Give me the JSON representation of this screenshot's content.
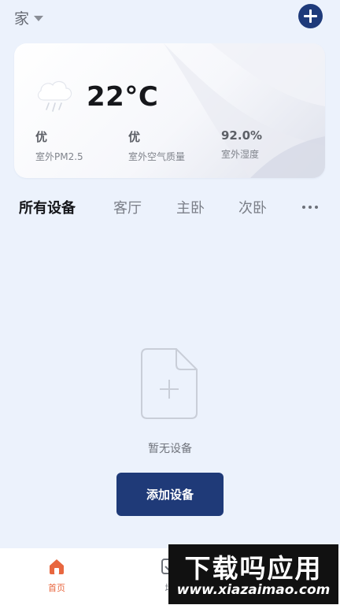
{
  "header": {
    "home_label": "家",
    "caret_icon": "caret-down-icon",
    "add_icon": "plus-circle-icon",
    "accent_color": "#1e3a7a"
  },
  "weather": {
    "icon": "cloud-rain-icon",
    "temperature": "22°C",
    "stats": [
      {
        "value": "优",
        "label": "室外PM2.5"
      },
      {
        "value": "优",
        "label": "室外空气质量"
      },
      {
        "value": "92.0%",
        "label": "室外湿度"
      }
    ]
  },
  "tabs": {
    "items": [
      {
        "label": "所有设备",
        "active": true
      },
      {
        "label": "客厅",
        "active": false
      },
      {
        "label": "主卧",
        "active": false
      },
      {
        "label": "次卧",
        "active": false
      }
    ],
    "more_icon": "more-horizontal-icon"
  },
  "empty_state": {
    "icon": "file-add-icon",
    "text": "暂无设备",
    "button_label": "添加设备",
    "button_color": "#1f3a78"
  },
  "bottom_nav": {
    "items": [
      {
        "label": "首页",
        "icon": "home-icon",
        "active": true,
        "color": "#e8673f"
      },
      {
        "label": "场",
        "icon": "scene-icon",
        "active": false
      }
    ]
  },
  "watermark": {
    "title": "下载吗应用",
    "url": "www.xiazaimao.com"
  }
}
